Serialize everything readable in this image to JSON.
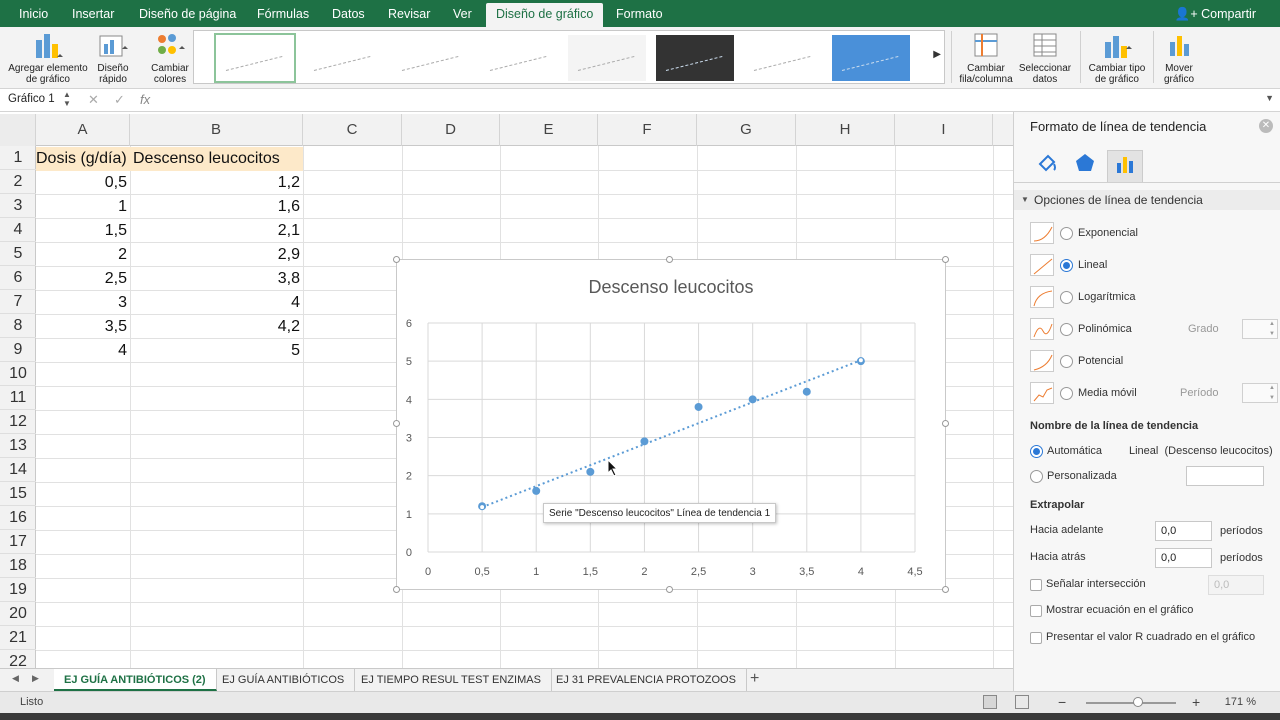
{
  "ribbon_tabs": [
    "Inicio",
    "Insertar",
    "Diseño de página",
    "Fórmulas",
    "Datos",
    "Revisar",
    "Ver",
    "Diseño de gráfico",
    "Formato"
  ],
  "active_tab": "Diseño de gráfico",
  "share_label": "Compartir",
  "ribbon": {
    "add_element": "Agregar elemento de gráfico",
    "quick_layout": "Diseño rápido",
    "change_colors": "Cambiar colores",
    "switch_row_col": "Cambiar fila/columna",
    "select_data": "Seleccionar datos",
    "change_type": "Cambiar tipo de gráfico",
    "move_chart": "Mover gráfico"
  },
  "formula_bar": {
    "name_box": "Gráfico 1",
    "fx": "fx"
  },
  "columns": [
    "A",
    "B",
    "C",
    "D",
    "E",
    "F",
    "G",
    "H",
    "I"
  ],
  "rows": [
    "1",
    "2",
    "3",
    "4",
    "5",
    "6",
    "7",
    "8",
    "9",
    "10",
    "11",
    "12",
    "13",
    "14",
    "15",
    "16",
    "17",
    "18",
    "19",
    "20",
    "21",
    "22"
  ],
  "sheet": {
    "header_a": "Dosis (g/día)",
    "header_b": "Descenso leucocitos",
    "col_a": [
      "0,5",
      "1",
      "1,5",
      "2",
      "2,5",
      "3",
      "3,5",
      "4"
    ],
    "col_b": [
      "1,2",
      "1,6",
      "2,1",
      "2,9",
      "3,8",
      "4",
      "4,2",
      "5"
    ]
  },
  "chart_data": {
    "type": "scatter",
    "title": "Descenso leucocitos",
    "x": [
      0.5,
      1,
      1.5,
      2,
      2.5,
      3,
      3.5,
      4
    ],
    "y": [
      1.2,
      1.6,
      2.1,
      2.9,
      3.8,
      4,
      4.2,
      5
    ],
    "xlim": [
      0,
      4.5
    ],
    "ylim": [
      0,
      6
    ],
    "x_ticks": [
      "0",
      "0,5",
      "1",
      "1,5",
      "2",
      "2,5",
      "3",
      "3,5",
      "4",
      "4,5"
    ],
    "y_ticks": [
      "0",
      "1",
      "2",
      "3",
      "4",
      "5",
      "6"
    ],
    "grid": true,
    "trendline": "linear",
    "series_color": "#5b9bd5"
  },
  "tooltip": "Serie \"Descenso leucocitos\" Línea de tendencia 1",
  "sheet_tabs": [
    "EJ GUÍA ANTIBIÓTICOS (2)",
    "EJ GUÍA ANTIBIÓTICOS",
    "EJ TIEMPO RESUL TEST ENZIMAS",
    "EJ 31 PREVALENCIA PROTOZOOS"
  ],
  "add_sheet": "+",
  "status": {
    "text": "Listo",
    "zoom": "171 %",
    "minus": "−",
    "plus": "+"
  },
  "pane": {
    "title": "Formato de línea de tendencia",
    "section": "Opciones de línea de tendencia",
    "options": [
      "Exponencial",
      "Lineal",
      "Logarítmica",
      "Polinómica",
      "Potencial",
      "Media móvil"
    ],
    "grado_label": "Grado",
    "periodo_label": "Período",
    "name_header": "Nombre de la línea de tendencia",
    "auto_label": "Automática",
    "auto_value": "Lineal  (Descenso leucocitos)",
    "custom_label": "Personalizada",
    "extrapolate_header": "Extrapolar",
    "forward_label": "Hacia adelante",
    "forward_value": "0,0",
    "backward_label": "Hacia atrás",
    "backward_value": "0,0",
    "periods_label": "períodos",
    "intercept_label": "Señalar intersección",
    "intercept_value": "0,0",
    "show_equation": "Mostrar ecuación en el gráfico",
    "show_r2": "Presentar el valor R cuadrado en el gráfico"
  }
}
